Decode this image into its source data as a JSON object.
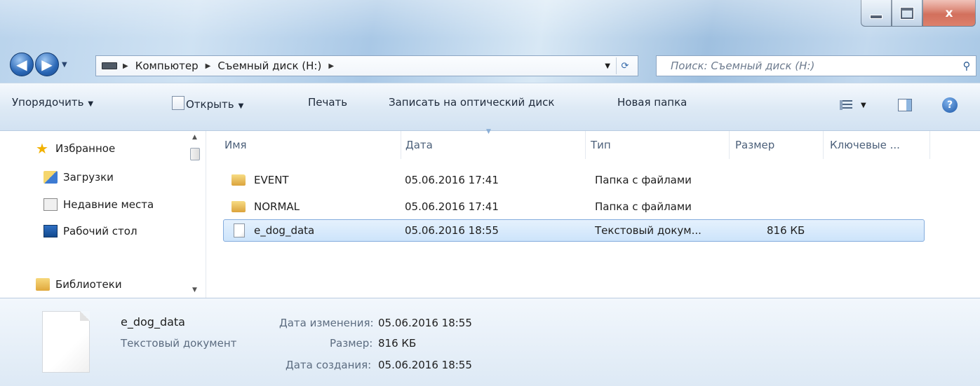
{
  "window": {
    "close_glyph": "x"
  },
  "address": {
    "crumbs": [
      "Компьютер",
      "Съемный диск (H:)"
    ]
  },
  "search": {
    "placeholder": "Поиск: Съемный диск (H:)"
  },
  "toolbar": {
    "organize": "Упорядочить",
    "open": "Открыть",
    "print": "Печать",
    "burn": "Записать на оптический диск",
    "new_folder": "Новая папка"
  },
  "sidebar": {
    "items": [
      {
        "label": "Избранное",
        "icon": "star-icon"
      },
      {
        "label": "Загрузки",
        "icon": "downloads-icon"
      },
      {
        "label": "Недавние места",
        "icon": "recent-places-icon"
      },
      {
        "label": "Рабочий стол",
        "icon": "desktop-icon"
      },
      {
        "label": "Библиотеки",
        "icon": "libraries-icon"
      }
    ]
  },
  "columns": [
    "Имя",
    "Дата",
    "Тип",
    "Размер",
    "Ключевые ..."
  ],
  "files": [
    {
      "name": "EVENT",
      "date": "05.06.2016 17:41",
      "type": "Папка с файлами",
      "size": ""
    },
    {
      "name": "NORMAL",
      "date": "05.06.2016 17:41",
      "type": "Папка с файлами",
      "size": ""
    },
    {
      "name": "e_dog_data",
      "date": "05.06.2016 18:55",
      "type": "Текстовый докум...",
      "size": "816 КБ"
    }
  ],
  "details": {
    "name": "e_dog_data",
    "kind": "Текстовый документ",
    "modified_label": "Дата изменения:",
    "modified_value": "05.06.2016 18:55",
    "size_label": "Размер:",
    "size_value": "816 КБ",
    "created_label": "Дата создания:",
    "created_value": "05.06.2016 18:55"
  }
}
